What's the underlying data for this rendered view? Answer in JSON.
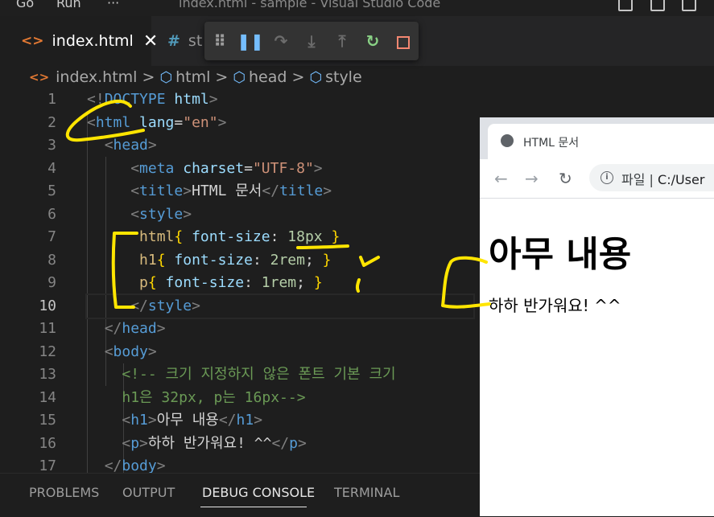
{
  "titlebar": {
    "menu_go": "Go",
    "menu_run": "Run",
    "menu_more": "···",
    "window_title": "index.html - sample - Visual Studio Code"
  },
  "tabs": {
    "active_icon": "<>",
    "active_label": "index.html",
    "active_close": "✕",
    "inactive_icon": "#",
    "inactive_label": "st"
  },
  "debug_toolbar": {
    "grip_icon": "grip-icon",
    "pause_icon": "pause-icon",
    "step_over_icon": "step-over-icon",
    "step_into_icon": "step-into-icon",
    "step_out_icon": "step-out-icon",
    "restart_icon": "restart-icon",
    "stop_icon": "stop-icon",
    "colors": {
      "pause": "#75beff",
      "restart": "#89d185",
      "stop": "#f48771",
      "disabled": "#6c6c6c"
    }
  },
  "breadcrumb": {
    "file": "index.html",
    "sep": ">",
    "items": [
      "html",
      "head",
      "style"
    ]
  },
  "editor": {
    "line_numbers": [
      "1",
      "2",
      "3",
      "4",
      "5",
      "6",
      "7",
      "8",
      "9",
      "10",
      "11",
      "12",
      "13",
      "14",
      "15",
      "16",
      "17"
    ],
    "current_line": "10",
    "code": {
      "l1_open": "<!",
      "l1_kw": "DOCTYPE",
      "l1_sp": " ",
      "l1_name": "html",
      "l1_close": ">",
      "lt": "<",
      "gt": ">",
      "lt_slash": "</",
      "tag_html": "html",
      "tag_head": "head",
      "tag_meta": "meta",
      "tag_title": "title",
      "tag_style": "style",
      "tag_body": "body",
      "tag_h1": "h1",
      "tag_p": "p",
      "attr_lang": " lang",
      "attr_charset": " charset",
      "eq": "=",
      "val_en": "\"en\"",
      "val_utf8": "\"UTF-8\"",
      "title_text": "HTML 문서",
      "css_html_sel": "html",
      "css_h1_sel": "h1",
      "css_p_sel": "p",
      "brace_open": "{",
      "brace_close": "}",
      "prop_fs": " font-size",
      "colon": ": ",
      "val_18px": "18px",
      "val_2rem": "2rem",
      "val_1rem": "1rem",
      "semi": ";",
      "comment_1": "<!-- 크기 지정하지 않은 폰트 기본 크기",
      "comment_2": "h1은 32px, p는 16px-->",
      "h1_text": "아무 내용",
      "p_text": "하하 반가워요! ^^"
    }
  },
  "panel": {
    "tabs": [
      "PROBLEMS",
      "OUTPUT",
      "DEBUG CONSOLE",
      "TERMINAL"
    ],
    "active": "DEBUG CONSOLE"
  },
  "browser": {
    "tab_title": "HTML 문서",
    "tab_close": "×",
    "back": "←",
    "forward": "→",
    "reload": "↻",
    "info": "i",
    "address_prefix": "파일 | ",
    "address_url": "C:/User",
    "h1": "아무 내용",
    "p": "하하 반가워요! ^^"
  },
  "annotation_color": "#ffe500"
}
